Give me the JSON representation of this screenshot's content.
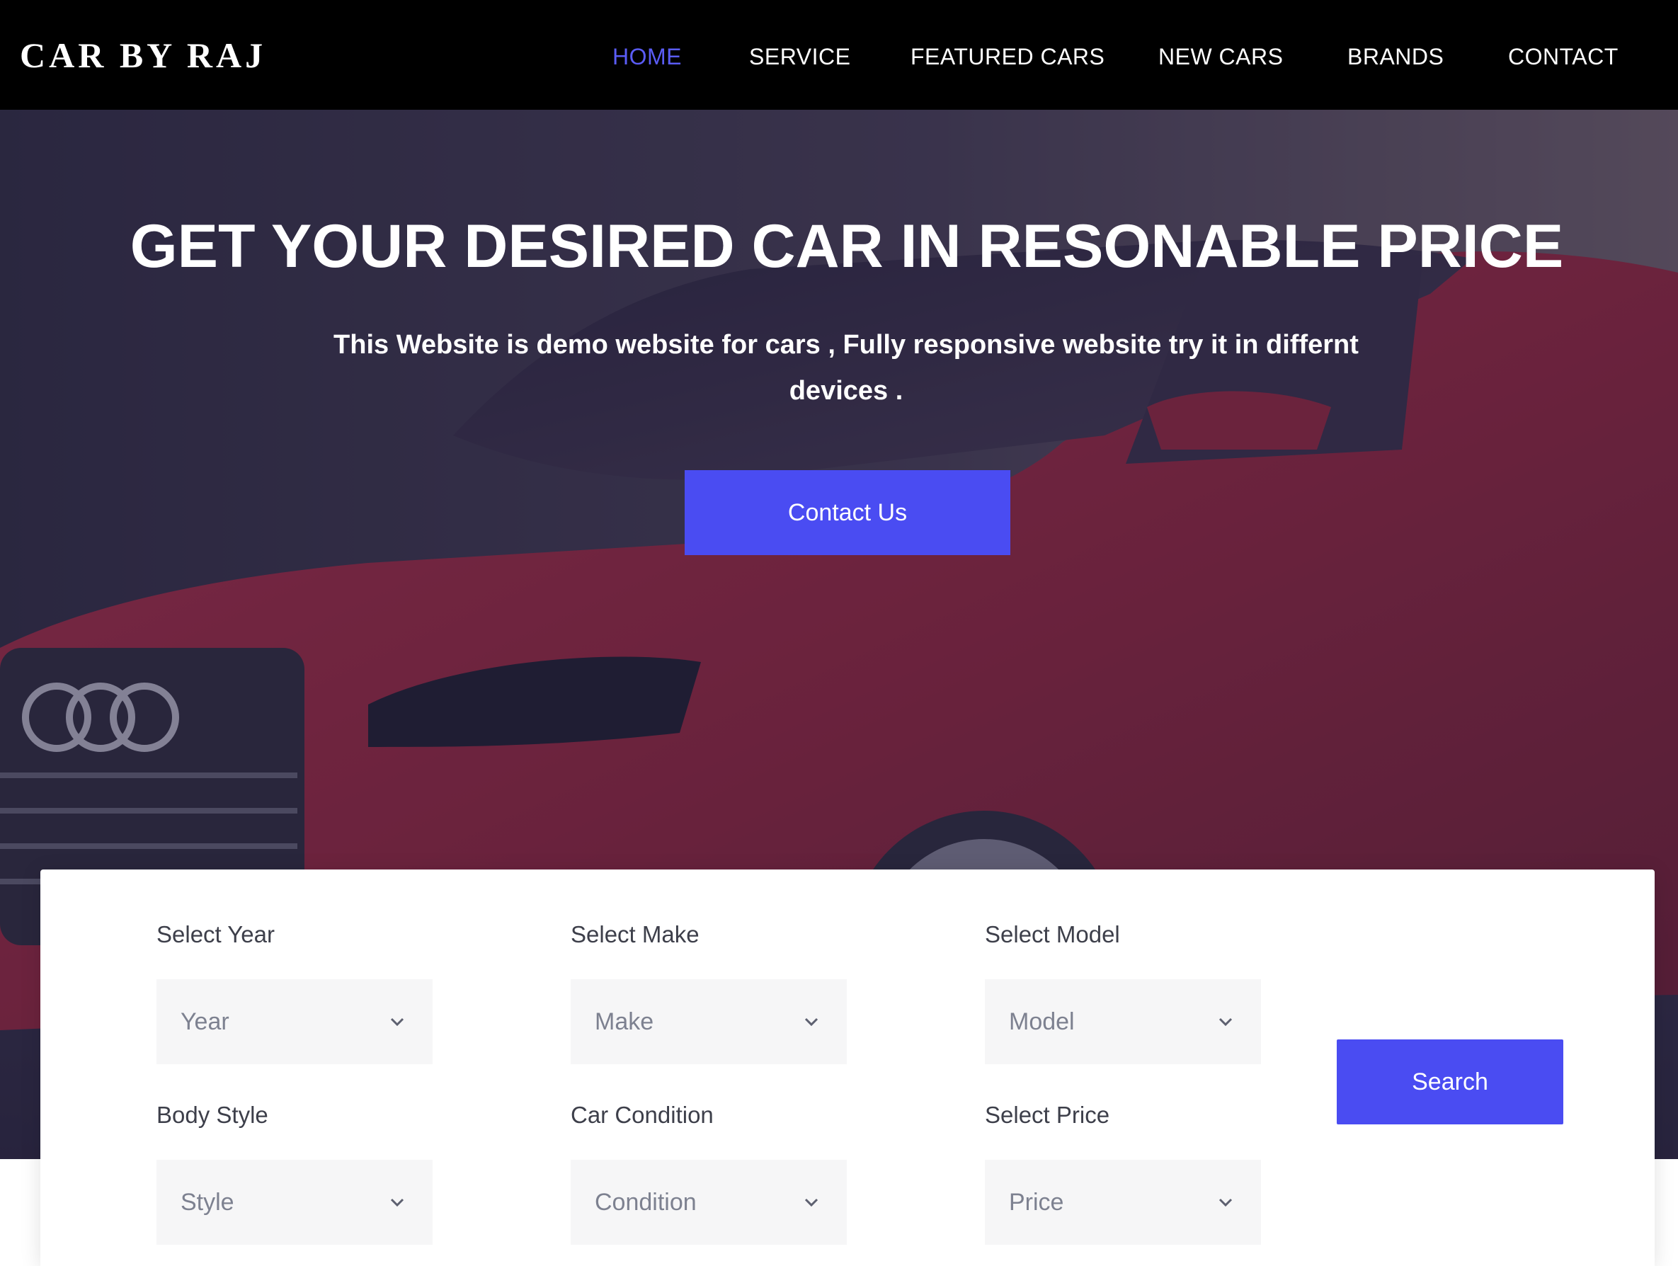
{
  "brand": "CAR BY RAJ",
  "nav": {
    "items": [
      {
        "label": "HOME",
        "active": true
      },
      {
        "label": "SERVICE",
        "active": false
      },
      {
        "label": "FEATURED CARS",
        "active": false
      },
      {
        "label": "NEW CARS",
        "active": false
      },
      {
        "label": "BRANDS",
        "active": false
      },
      {
        "label": "CONTACT",
        "active": false
      }
    ]
  },
  "hero": {
    "title": "GET YOUR DESIRED CAR IN RESONABLE PRICE",
    "subtitle": "This Website is demo website for cars , Fully responsive website try it in differnt devices .",
    "cta_label": "Contact Us",
    "background": "red-car-photo"
  },
  "search": {
    "fields": [
      {
        "label": "Select Year",
        "value": "Year"
      },
      {
        "label": "Select Make",
        "value": "Make"
      },
      {
        "label": "Select Model",
        "value": "Model"
      },
      {
        "label": "Body Style",
        "value": "Style"
      },
      {
        "label": "Car Condition",
        "value": "Condition"
      },
      {
        "label": "Select Price",
        "value": "Price"
      }
    ],
    "button_label": "Search"
  },
  "colors": {
    "accent": "#4a4cf2",
    "nav_active": "#5a5cf5",
    "nav_bg": "#000000",
    "car": "#b8293a"
  },
  "icons": {
    "dropdown": "chevron-down-icon"
  }
}
